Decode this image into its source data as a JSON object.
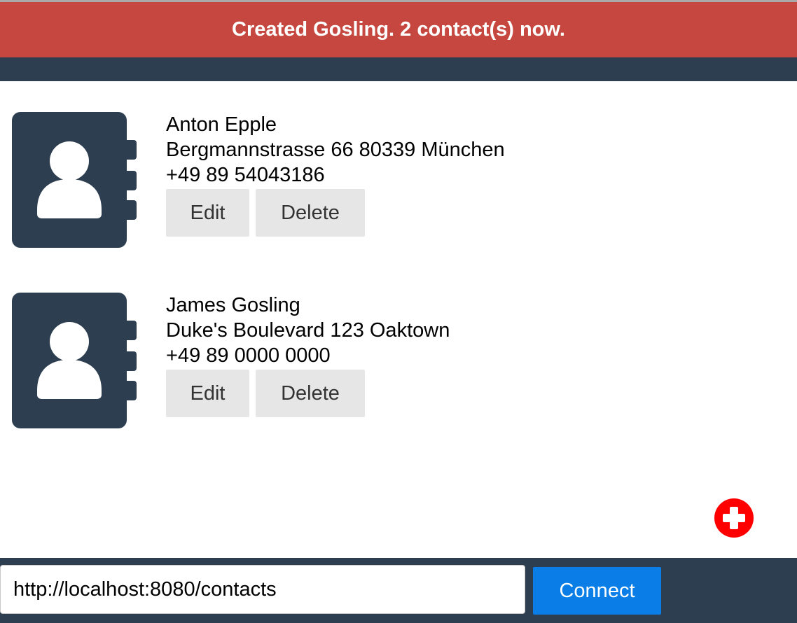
{
  "notification": {
    "message": "Created Gosling. 2 contact(s) now."
  },
  "contacts": [
    {
      "name": "Anton Epple",
      "address": "Bergmannstrasse 66 80339 München",
      "phone": "+49 89 54043186",
      "edit_label": "Edit",
      "delete_label": "Delete",
      "icon": "contact-book-icon"
    },
    {
      "name": "James Gosling",
      "address": "Duke's Boulevard 123 Oaktown",
      "phone": "+49 89 0000 0000",
      "edit_label": "Edit",
      "delete_label": "Delete",
      "icon": "contact-book-icon"
    }
  ],
  "add_button": {
    "icon": "plus-circle-icon"
  },
  "footer": {
    "url_value": "http://localhost:8080/contacts",
    "connect_label": "Connect"
  },
  "colors": {
    "banner": "#c6473f",
    "dark": "#2d3e50",
    "button_bg": "#e6e6e6",
    "accent": "#0a7ee6",
    "add": "#ff0000"
  }
}
